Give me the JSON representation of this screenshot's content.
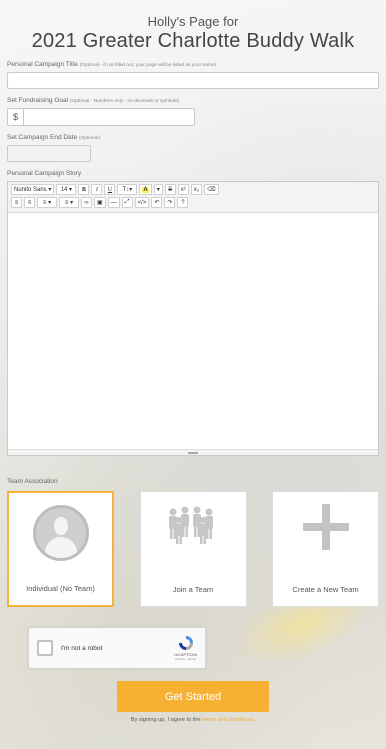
{
  "header": {
    "subtitle": "Holly's Page for",
    "title": "2021 Greater Charlotte Buddy Walk"
  },
  "form": {
    "campaign_title": {
      "label": "Personal Campaign Title",
      "hint": "(Optional - if not filled out, your page will be listed as your name)",
      "value": ""
    },
    "fundraising_goal": {
      "label": "Set Fundraising Goal",
      "hint": "(Optional - Numbers only - no decimals or symbols)",
      "currency": "$",
      "value": ""
    },
    "end_date": {
      "label": "Set Campaign End Date",
      "hint": "(Optional)",
      "value": ""
    },
    "story": {
      "label": "Personal Campaign Story",
      "toolbar": {
        "font_family": "Nunito Sans ▾",
        "font_size": "14 ▾",
        "bold": "B",
        "italic": "I",
        "underline": "U",
        "text_size": "T↕▾",
        "highlight": "A",
        "highlight_caret": "▾",
        "strikethrough": "S",
        "superscript": "x²",
        "subscript": "x₂",
        "eraser": "⌫",
        "unordered_list": "≡",
        "ordered_list": "≡",
        "align": "≡ ▾",
        "line_height": "≡ ▾",
        "link": "∞",
        "image": "▣",
        "hr": "—",
        "fullscreen": "⤢",
        "code": "</>",
        "undo": "↶",
        "redo": "↷",
        "help": "?"
      }
    }
  },
  "team": {
    "label": "Team Association",
    "options": [
      {
        "label": "Individual (No Team)",
        "selected": true,
        "icon": "person-icon"
      },
      {
        "label": "Join a Team",
        "selected": false,
        "icon": "group-icon"
      },
      {
        "label": "Create a New Team",
        "selected": false,
        "icon": "plus-icon"
      }
    ]
  },
  "captcha": {
    "label": "I'm not a robot",
    "brand": "reCAPTCHA",
    "terms": "Privacy - Terms"
  },
  "cta": {
    "label": "Get Started"
  },
  "signup": {
    "prefix": "By signing up, I agree to the",
    "link": "terms and conditions."
  },
  "colors": {
    "accent": "#f6b133",
    "selected_border": "#f3b33d",
    "link": "#f0a93a"
  }
}
